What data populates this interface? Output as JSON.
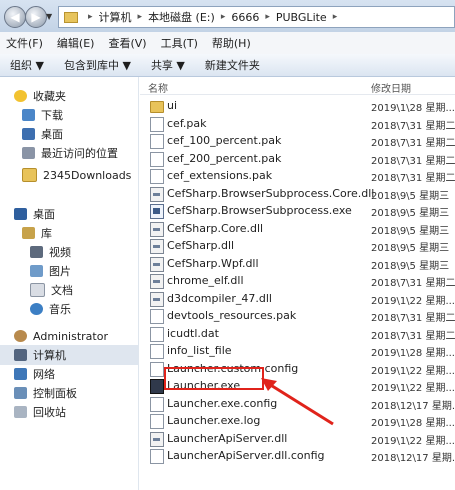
{
  "address_bar": {
    "crumbs": [
      "计算机",
      "本地磁盘 (E:)",
      "6666",
      "PUBGLite"
    ]
  },
  "menu": [
    "文件(F)",
    "编辑(E)",
    "查看(V)",
    "工具(T)",
    "帮助(H)"
  ],
  "toolbar": [
    "组织 ▼",
    "包含到库中 ▼",
    "共享 ▼",
    "新建文件夹"
  ],
  "nav": {
    "favorites": "收藏夹",
    "downloads": "下载",
    "desktop_fav": "桌面",
    "recent": "最近访问的位置",
    "downloads2345": "2345Downloads",
    "desktop": "桌面",
    "library": "库",
    "video": "视频",
    "pictures": "图片",
    "documents": "文档",
    "music": "音乐",
    "admin": "Administrator",
    "computer": "计算机",
    "network": "网络",
    "control_panel": "控制面板",
    "recycle": "回收站"
  },
  "columns": {
    "name": "名称",
    "modified": "修改日期"
  },
  "files": [
    {
      "name": "ui",
      "date": "2019\\1\\28 星期...",
      "type": "folder"
    },
    {
      "name": "cef.pak",
      "date": "2018\\7\\31 星期二",
      "type": "pak"
    },
    {
      "name": "cef_100_percent.pak",
      "date": "2018\\7\\31 星期二",
      "type": "pak"
    },
    {
      "name": "cef_200_percent.pak",
      "date": "2018\\7\\31 星期二",
      "type": "pak"
    },
    {
      "name": "cef_extensions.pak",
      "date": "2018\\7\\31 星期二",
      "type": "pak"
    },
    {
      "name": "CefSharp.BrowserSubprocess.Core.dll",
      "date": "2018\\9\\5 星期三",
      "type": "dll"
    },
    {
      "name": "CefSharp.BrowserSubprocess.exe",
      "date": "2018\\9\\5 星期三",
      "type": "exe"
    },
    {
      "name": "CefSharp.Core.dll",
      "date": "2018\\9\\5 星期三",
      "type": "dll"
    },
    {
      "name": "CefSharp.dll",
      "date": "2018\\9\\5 星期三",
      "type": "dll"
    },
    {
      "name": "CefSharp.Wpf.dll",
      "date": "2018\\9\\5 星期三",
      "type": "dll"
    },
    {
      "name": "chrome_elf.dll",
      "date": "2018\\7\\31 星期二",
      "type": "dll"
    },
    {
      "name": "d3dcompiler_47.dll",
      "date": "2019\\1\\22 星期...",
      "type": "dll"
    },
    {
      "name": "devtools_resources.pak",
      "date": "2018\\7\\31 星期二",
      "type": "pak"
    },
    {
      "name": "icudtl.dat",
      "date": "2018\\7\\31 星期二",
      "type": "file"
    },
    {
      "name": "info_list_file",
      "date": "2019\\1\\28 星期...",
      "type": "file"
    },
    {
      "name": "Launcher.custom.config",
      "date": "2019\\1\\22 星期...",
      "type": "file"
    },
    {
      "name": "Launcher.exe",
      "date": "2019\\1\\22 星期...",
      "type": "launch"
    },
    {
      "name": "Launcher.exe.config",
      "date": "2018\\12\\17 星期...",
      "type": "file"
    },
    {
      "name": "Launcher.exe.log",
      "date": "2019\\1\\28 星期...",
      "type": "file"
    },
    {
      "name": "LauncherApiServer.dll",
      "date": "2019\\1\\22 星期...",
      "type": "dll"
    },
    {
      "name": "LauncherApiServer.dll.config",
      "date": "2018\\12\\17 星期...",
      "type": "file"
    }
  ]
}
